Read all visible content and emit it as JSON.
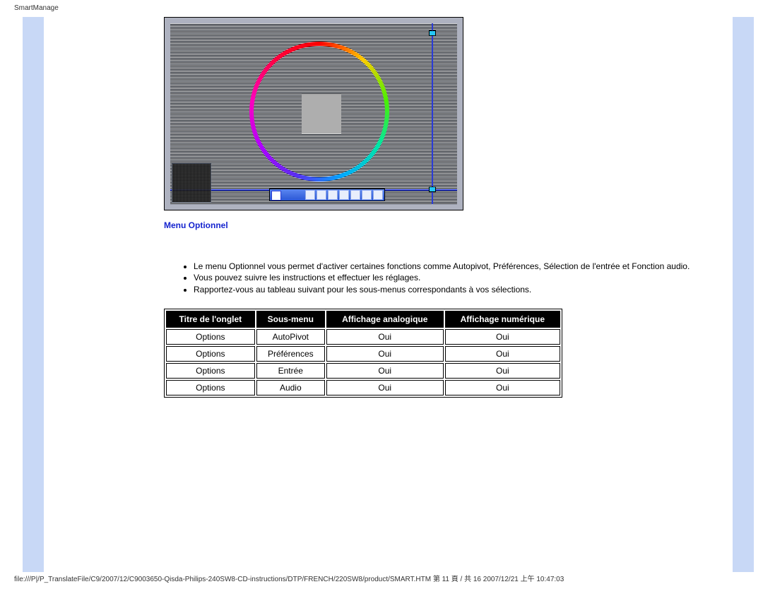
{
  "page_title": "SmartManage",
  "section_title": "Menu Optionnel",
  "bullets": [
    "Le menu Optionnel vous permet d'activer certaines fonctions comme Autopivot, Préférences, Sélection de l'entrée et Fonction audio.",
    "Vous pouvez suivre les instructions et effectuer les réglages.",
    "Rapportez-vous au tableau suivant pour les sous-menus correspondants à vos sélections."
  ],
  "table": {
    "headers": [
      "Titre de l'onglet",
      "Sous-menu",
      "Affichage analogique",
      "Affichage numérique"
    ],
    "rows": [
      [
        "Options",
        "AutoPivot",
        "Oui",
        "Oui"
      ],
      [
        "Options",
        "Préférences",
        "Oui",
        "Oui"
      ],
      [
        "Options",
        "Entrée",
        "Oui",
        "Oui"
      ],
      [
        "Options",
        "Audio",
        "Oui",
        "Oui"
      ]
    ]
  },
  "footer": "file:///P|/P_TranslateFile/C9/2007/12/C9003650-Qisda-Philips-240SW8-CD-instructions/DTP/FRENCH/220SW8/product/SMART.HTM 第 11 頁 / 共 16 2007/12/21 上午 10:47:03"
}
